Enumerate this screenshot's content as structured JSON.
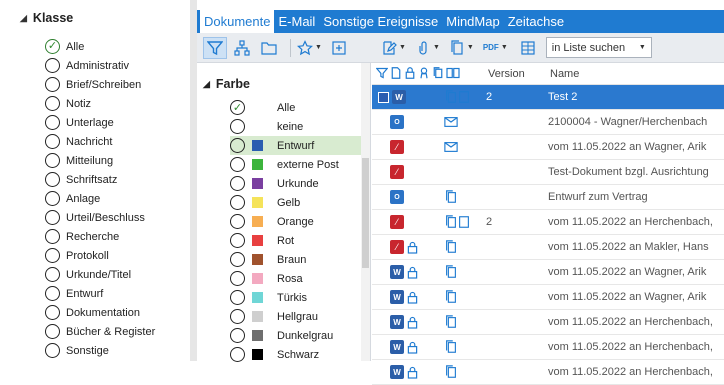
{
  "left": {
    "header": "Klasse",
    "items": [
      {
        "label": "Alle",
        "checked": true
      },
      {
        "label": "Administrativ"
      },
      {
        "label": "Brief/Schreiben"
      },
      {
        "label": "Notiz"
      },
      {
        "label": "Unterlage"
      },
      {
        "label": "Nachricht"
      },
      {
        "label": "Mitteilung"
      },
      {
        "label": "Schriftsatz"
      },
      {
        "label": "Anlage"
      },
      {
        "label": "Urteil/Beschluss"
      },
      {
        "label": "Recherche"
      },
      {
        "label": "Protokoll"
      },
      {
        "label": "Urkunde/Titel"
      },
      {
        "label": "Entwurf"
      },
      {
        "label": "Dokumentation"
      },
      {
        "label": "Bücher & Register"
      },
      {
        "label": "Sonstige"
      }
    ]
  },
  "tabs": [
    "Dokumente",
    "E-Mail",
    "Sonstige Ereignisse",
    "MindMap",
    "Zeitachse"
  ],
  "toolbar": {
    "search_label": "in Liste suchen",
    "pdf_label": "PDF"
  },
  "farbe": {
    "header": "Farbe",
    "items": [
      {
        "label": "Alle",
        "checked": true,
        "color": ""
      },
      {
        "label": "keine",
        "color": ""
      },
      {
        "label": "Entwurf",
        "color": "#2a5db0",
        "selected": true
      },
      {
        "label": "externe Post",
        "color": "#3cb43c"
      },
      {
        "label": "Urkunde",
        "color": "#7a3fa0"
      },
      {
        "label": "Gelb",
        "color": "#f5e35a"
      },
      {
        "label": "Orange",
        "color": "#f7ae52"
      },
      {
        "label": "Rot",
        "color": "#e84040"
      },
      {
        "label": "Braun",
        "color": "#a0522d"
      },
      {
        "label": "Rosa",
        "color": "#f3a9c0"
      },
      {
        "label": "Türkis",
        "color": "#6fd6d6"
      },
      {
        "label": "Hellgrau",
        "color": "#cfcfcf"
      },
      {
        "label": "Dunkelgrau",
        "color": "#6e6e6e"
      },
      {
        "label": "Schwarz",
        "color": "#000000"
      }
    ]
  },
  "grid": {
    "col_version": "Version",
    "col_name": "Name",
    "rows": [
      {
        "type": "word",
        "color_mark": true,
        "attach": "copy2",
        "version": "2",
        "name": "Test 2",
        "selected": true
      },
      {
        "type": "outlook",
        "attach": "mail",
        "version": "",
        "name": "2100004 - Wagner/Herchenbach"
      },
      {
        "type": "pdf",
        "attach": "mail",
        "version": "",
        "name": "vom 11.05.2022 an Wagner, Arik"
      },
      {
        "type": "pdf",
        "attach": "",
        "version": "",
        "name": "Test-Dokument bzgl. Ausrichtung"
      },
      {
        "type": "outlook",
        "attach": "copy",
        "version": "",
        "name": "Entwurf zum Vertrag"
      },
      {
        "type": "pdf",
        "attach": "copy2",
        "version": "2",
        "name": "vom 11.05.2022 an Herchenbach,"
      },
      {
        "type": "pdf",
        "lock": true,
        "attach": "copy",
        "version": "",
        "name": "vom 11.05.2022 an Makler, Hans"
      },
      {
        "type": "word",
        "lock": true,
        "attach": "copy",
        "version": "",
        "name": "vom 11.05.2022 an Wagner, Arik"
      },
      {
        "type": "word",
        "lock": true,
        "attach": "copy",
        "version": "",
        "name": "vom 11.05.2022 an Wagner, Arik"
      },
      {
        "type": "word",
        "lock": true,
        "attach": "copy",
        "version": "",
        "name": "vom 11.05.2022 an Herchenbach,"
      },
      {
        "type": "word",
        "lock": true,
        "attach": "copy",
        "version": "",
        "name": "vom 11.05.2022 an Herchenbach,"
      },
      {
        "type": "word",
        "lock": true,
        "attach": "copy",
        "version": "",
        "name": "vom 11.05.2022 an Herchenbach,"
      }
    ]
  }
}
